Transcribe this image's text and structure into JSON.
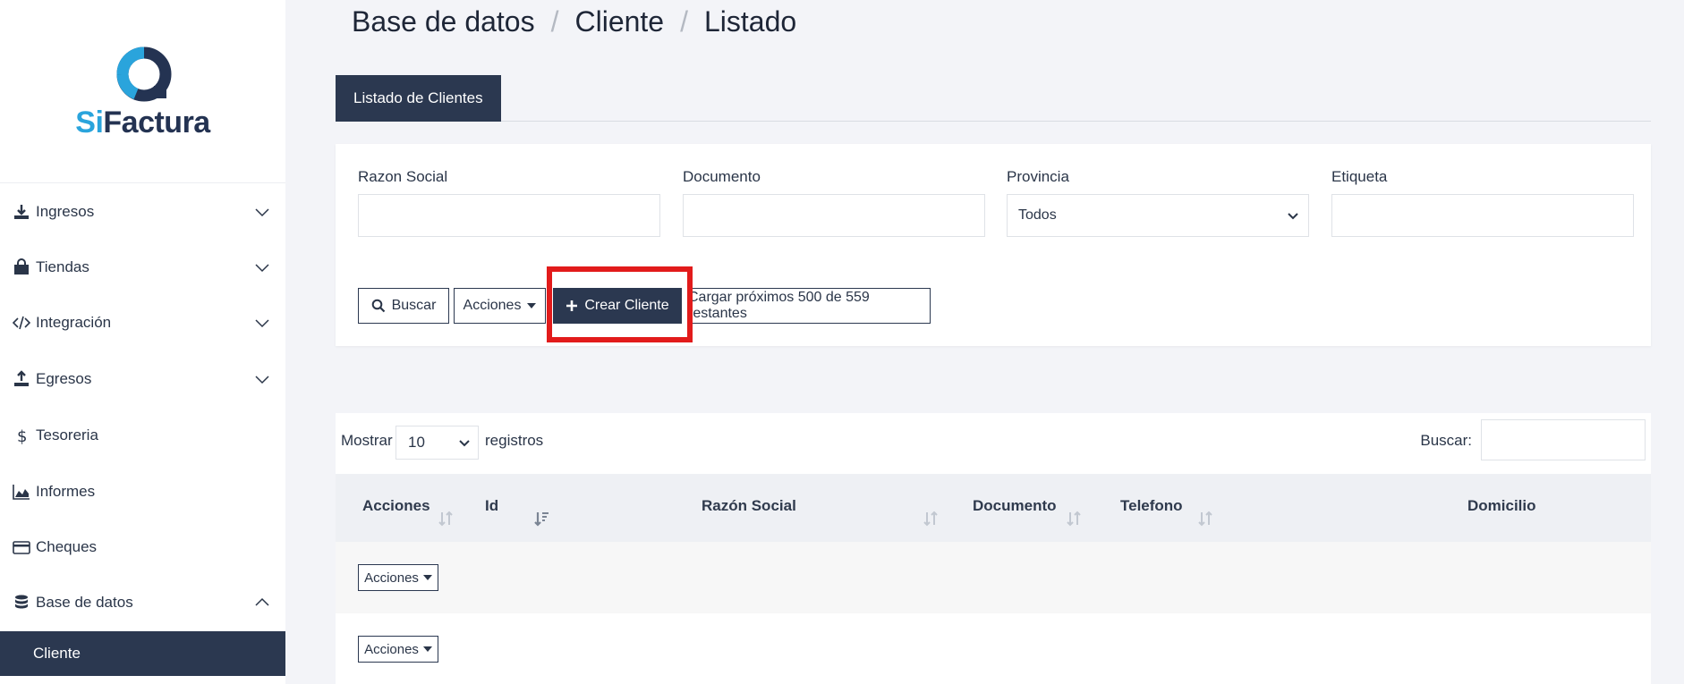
{
  "brand": {
    "logo_si": "Si",
    "logo_factura": "Factura"
  },
  "sidebar": {
    "items": [
      {
        "label": "Ingresos"
      },
      {
        "label": "Tiendas"
      },
      {
        "label": "Integración"
      },
      {
        "label": "Egresos"
      },
      {
        "label": "Tesoreria"
      },
      {
        "label": "Informes"
      },
      {
        "label": "Cheques"
      },
      {
        "label": "Base de datos"
      }
    ],
    "active_subitem": "Cliente"
  },
  "breadcrumb": [
    "Base de datos",
    "Cliente",
    "Listado"
  ],
  "tabs": [
    {
      "label": "Listado de Clientes"
    }
  ],
  "filters": {
    "razon_social_label": "Razon Social",
    "documento_label": "Documento",
    "provincia_label": "Provincia",
    "provincia_value": "Todos",
    "etiqueta_label": "Etiqueta"
  },
  "toolbar": {
    "search_label": "Buscar",
    "actions_label": "Acciones",
    "create_label": "Crear Cliente",
    "load_more_label": "Cargar próximos 500 de 559 restantes"
  },
  "table": {
    "show_label": "Mostrar",
    "page_size": "10",
    "records_label": "registros",
    "search_label": "Buscar:",
    "columns": [
      "Acciones",
      "Id",
      "Razón Social",
      "Documento",
      "Telefono",
      "Domicilio"
    ],
    "row_action_label": "Acciones"
  },
  "colors": {
    "accent_dark": "#2b3850",
    "brand_blue": "#2aa4dc",
    "highlight": "#e21b1b"
  }
}
